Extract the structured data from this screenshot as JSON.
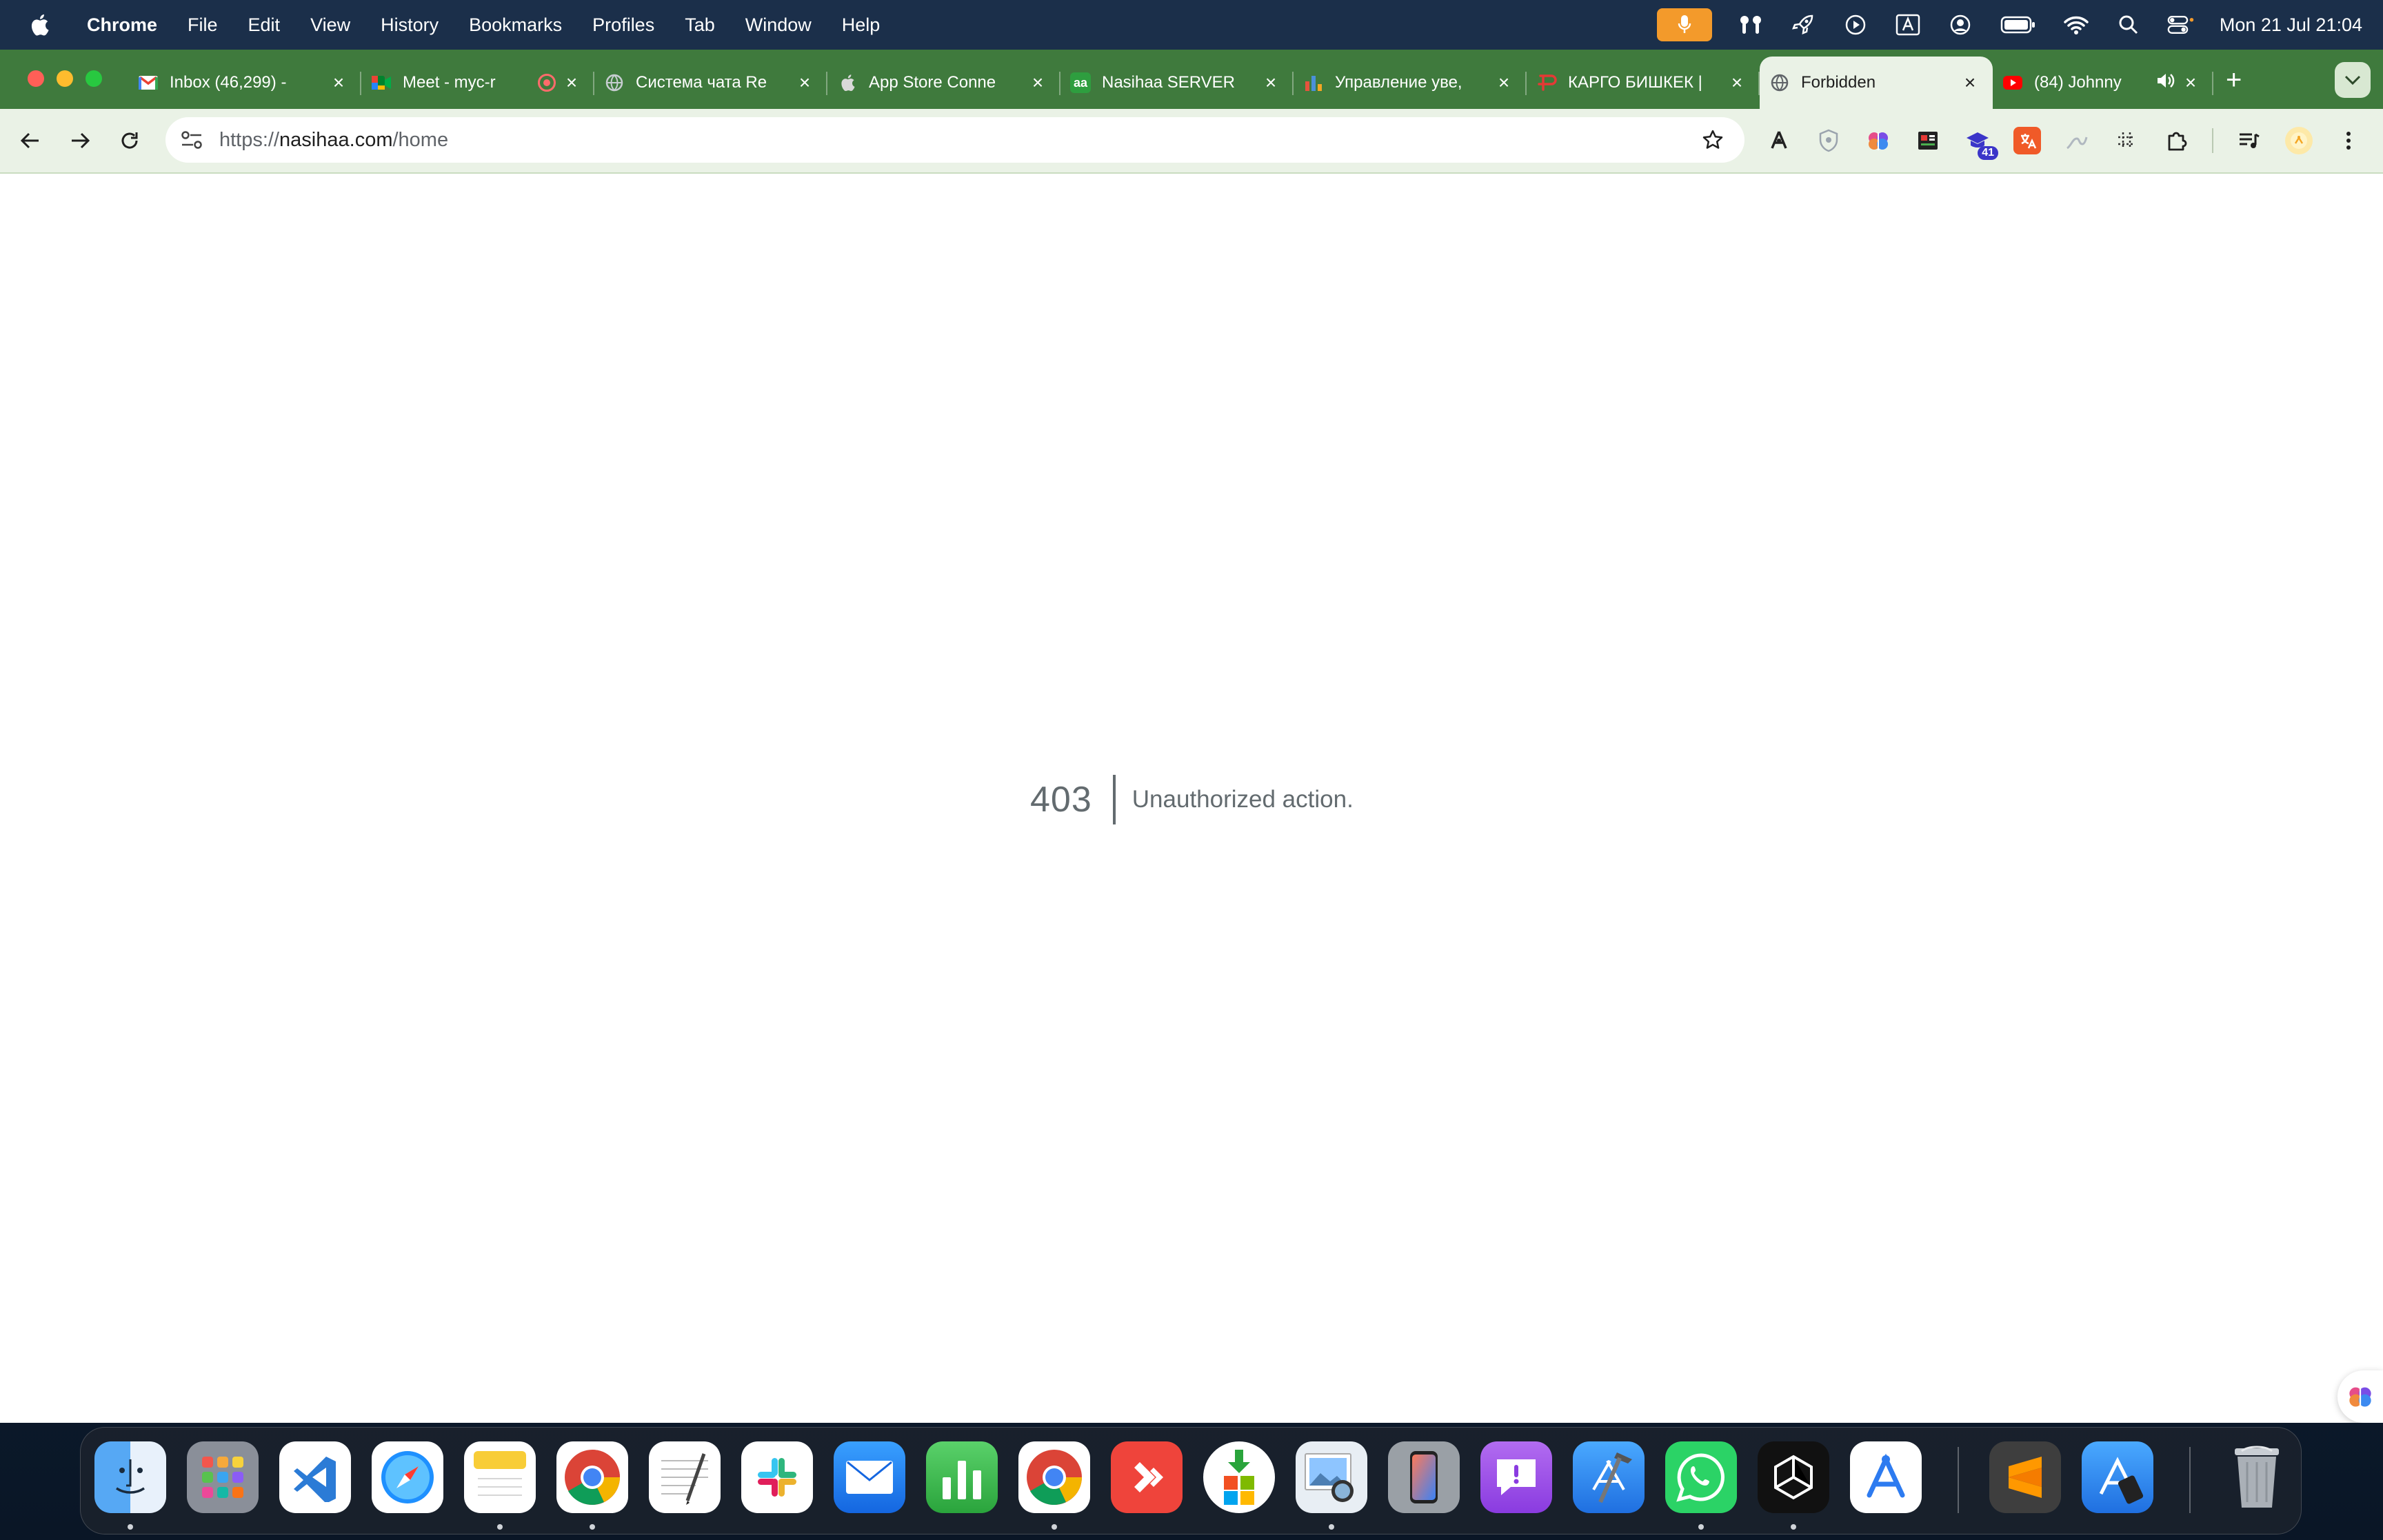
{
  "menubar": {
    "app_name": "Chrome",
    "menus": [
      "File",
      "Edit",
      "View",
      "History",
      "Bookmarks",
      "Profiles",
      "Tab",
      "Window",
      "Help"
    ],
    "clock": "Mon 21 Jul  21:04",
    "status_icons": [
      "microphone-icon",
      "airpods-icon",
      "rocket-icon",
      "play-icon",
      "input-source-a-icon",
      "user-icon",
      "battery-icon",
      "wifi-icon",
      "spotlight-search-icon",
      "control-center-icon"
    ]
  },
  "tabs": [
    {
      "title": "Inbox (46,299) -",
      "favicon": "gmail-icon",
      "favicon_color": "#ea4335"
    },
    {
      "title": "Meet - myc-r",
      "favicon": "meet-icon",
      "favicon_color": "#00832d",
      "recording": true
    },
    {
      "title": "Система чата Re",
      "favicon": "globe-icon",
      "favicon_color": "#9aa0a6"
    },
    {
      "title": "App Store Conne",
      "favicon": "apple-icon",
      "favicon_color": "#cccccc"
    },
    {
      "title": "Nasihaa SERVER",
      "favicon": "aa-icon",
      "favicon_color": "#2e9e3f",
      "favicon_text": "aa"
    },
    {
      "title": "Управление уве,",
      "favicon": "bar-chart-icon",
      "favicon_color": "#e5533d"
    },
    {
      "title": "КАРГО БИШКЕК |",
      "favicon": "cargo-icon",
      "favicon_color": "#e53935"
    },
    {
      "title": "Forbidden",
      "favicon": "globe-icon",
      "favicon_color": "#5f6368",
      "active": true
    },
    {
      "title": "(84) Johnny",
      "favicon": "youtube-icon",
      "favicon_color": "#ff0000",
      "audio": true
    }
  ],
  "address_bar": {
    "scheme": "https://",
    "host": "nasihaa.com",
    "path": "/home"
  },
  "extensions": [
    "extension-a-icon",
    "shield-extension-icon",
    "brain-extension-icon",
    "news-extension-icon",
    "graduation-extension-icon",
    "translate-extension-icon",
    "draw-extension-icon",
    "grid-extension-icon",
    "puzzle-extensions-icon",
    "media-control-icon",
    "profile-avatar-icon",
    "menu-kebab-icon"
  ],
  "extension_badge": "41",
  "error": {
    "code": "403",
    "message": "Unauthorized action."
  },
  "dock": [
    "finder-icon",
    "launchpad-icon",
    "vscode-icon",
    "safari-icon",
    "notes-icon",
    "chrome-icon",
    "textedit-icon",
    "slack-icon",
    "mail-icon",
    "numbers-icon",
    "chrome-canary-icon",
    "anydesk-icon",
    "microsoft-installer-icon",
    "preview-icon",
    "iphone-mirroring-icon",
    "feedback-icon",
    "xcode-icon",
    "whatsapp-icon",
    "unity-icon",
    "app-store-connect-icon",
    "sublime-text-icon",
    "simulator-icon",
    "trash-icon"
  ]
}
